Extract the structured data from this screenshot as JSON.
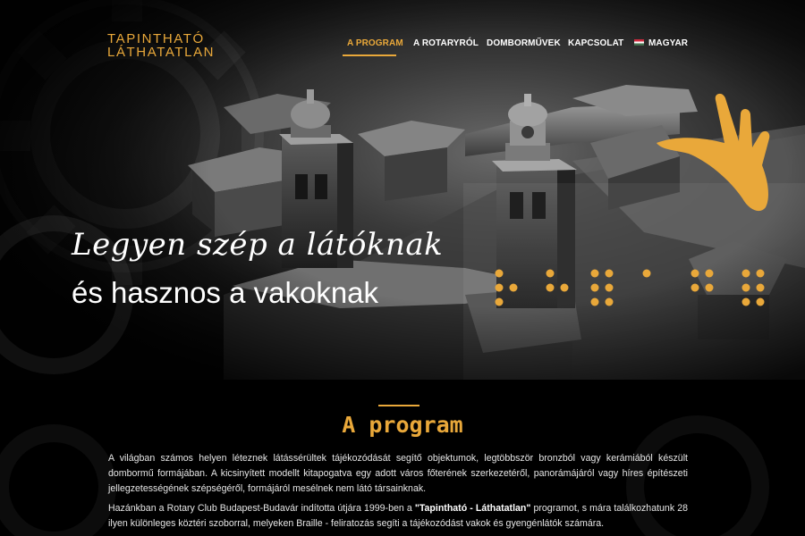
{
  "brand": {
    "line1": "TAPINTHATÓ",
    "line2": "LÁTHATATLAN",
    "color": "#e9a83a"
  },
  "nav": {
    "items": [
      {
        "label": "A PROGRAM",
        "active": true
      },
      {
        "label": "A ROTARYRÓL",
        "active": false
      },
      {
        "label": "DOMBORMŰVEK",
        "active": false
      },
      {
        "label": "KAPCSOLAT",
        "active": false
      }
    ],
    "language": {
      "label": "MAGYAR",
      "icon": "hungarian-flag-icon"
    }
  },
  "hero": {
    "tagline_line1": "Legyen szép a látóknak",
    "tagline_line2": "és hasznos a vakoknak",
    "icons": [
      "gear-icon",
      "hand-icon",
      "braille-dots-icon"
    ]
  },
  "program": {
    "title": "A program",
    "paragraph1": "A világban számos helyen léteznek látássérültek tájékozódását segítő objektumok, legtöbbször bronzból vagy kerámiából készült dombormű formájában. A kicsinyített modellt kitapogatva egy adott város főterének szerkezetéről, panorámájáról vagy híres építészeti jellegzetességének szépségéről, formájáról mesélnek nem látó társainknak.",
    "paragraph2_before": "Hazánkban a Rotary Club Budapest-Budavár indította útjára 1999-ben a ",
    "paragraph2_bold": "\"Tapintható - Láthatatlan\"",
    "paragraph2_after": " programot, s mára találkozhatunk 28 ilyen különleges köztéri szoborral, melyeken Braille - feliratozás segíti a tájékozódást vakok és gyengénlátók számára."
  },
  "colors": {
    "accent": "#e9a83a",
    "background": "#000000"
  }
}
